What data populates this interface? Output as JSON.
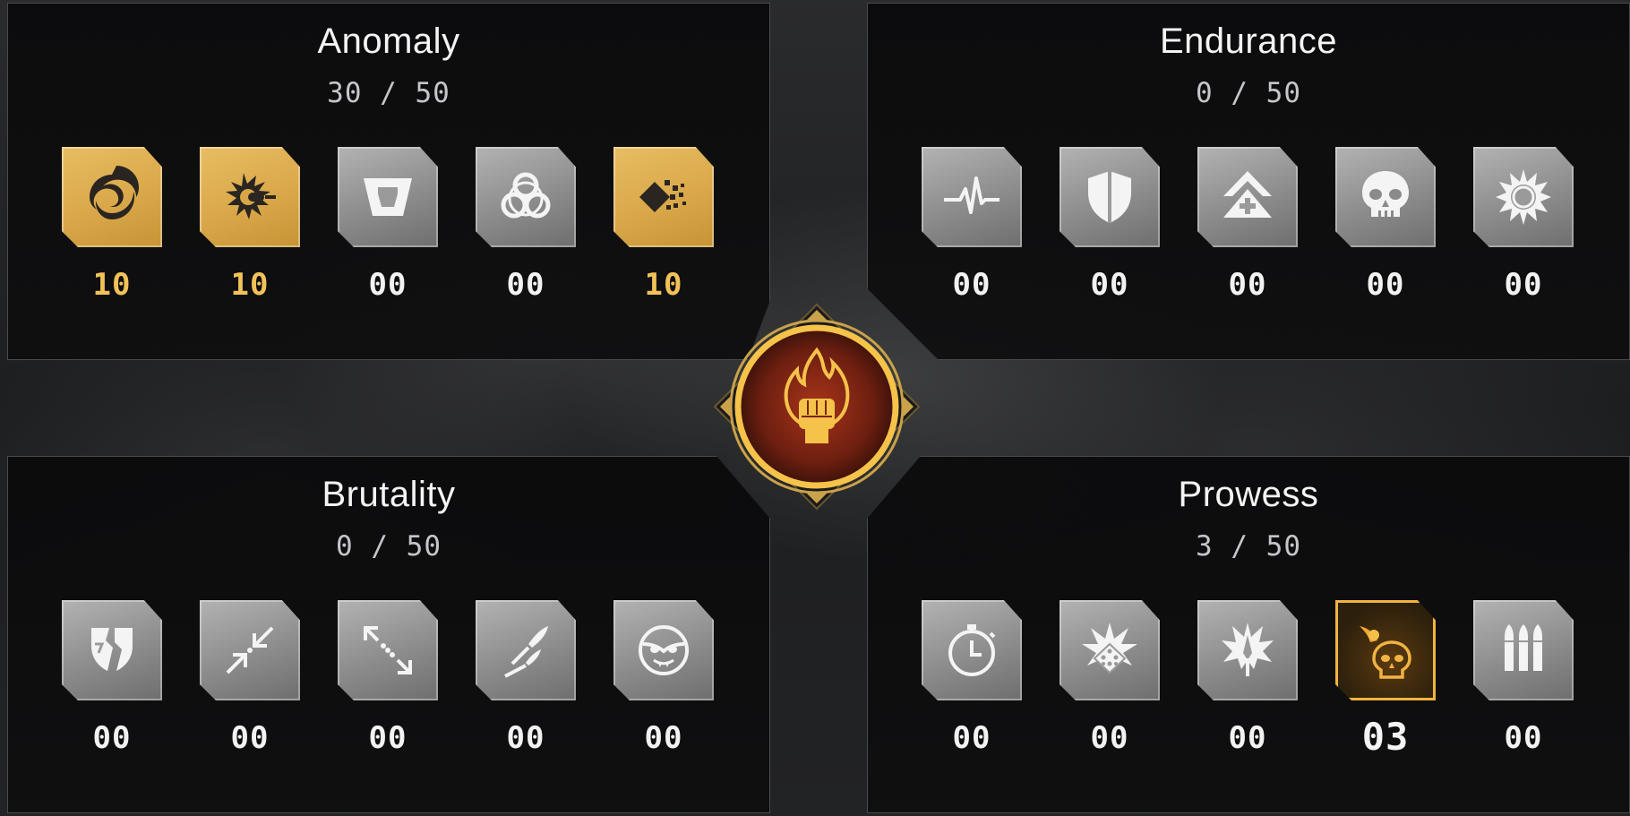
{
  "categories": [
    {
      "id": "anomaly",
      "title": "Anomaly",
      "score": "30 / 50",
      "tiles": [
        {
          "icon": "vortex-icon",
          "value": "10",
          "active": true
        },
        {
          "icon": "burning-bullet-icon",
          "value": "10",
          "active": true
        },
        {
          "icon": "trapezoid-icon",
          "value": "00",
          "active": false
        },
        {
          "icon": "biohazard-icon",
          "value": "00",
          "active": false
        },
        {
          "icon": "disintegrate-icon",
          "value": "10",
          "active": true
        }
      ]
    },
    {
      "id": "endurance",
      "title": "Endurance",
      "score": "0 / 50",
      "tiles": [
        {
          "icon": "heartbeat-icon",
          "value": "00",
          "active": false
        },
        {
          "icon": "shield-icon",
          "value": "00",
          "active": false
        },
        {
          "icon": "rank-heal-icon",
          "value": "00",
          "active": false
        },
        {
          "icon": "skull-icon",
          "value": "00",
          "active": false
        },
        {
          "icon": "sun-icon",
          "value": "00",
          "active": false
        }
      ]
    },
    {
      "id": "brutality",
      "title": "Brutality",
      "score": "0 / 50",
      "tiles": [
        {
          "icon": "broken-shield-icon",
          "value": "00",
          "active": false
        },
        {
          "icon": "converge-arrows-icon",
          "value": "00",
          "active": false
        },
        {
          "icon": "expand-arrows-icon",
          "value": "00",
          "active": false
        },
        {
          "icon": "blades-icon",
          "value": "00",
          "active": false
        },
        {
          "icon": "vampire-icon",
          "value": "00",
          "active": false
        }
      ]
    },
    {
      "id": "prowess",
      "title": "Prowess",
      "score": "3 / 50",
      "tiles": [
        {
          "icon": "stopwatch-icon",
          "value": "00",
          "active": false
        },
        {
          "icon": "explosive-dice-icon",
          "value": "00",
          "active": false
        },
        {
          "icon": "impact-blade-icon",
          "value": "00",
          "active": false
        },
        {
          "icon": "fire-skull-icon",
          "value": "03",
          "active": true,
          "selected": true
        },
        {
          "icon": "ammo-icon",
          "value": "00",
          "active": false
        }
      ]
    }
  ],
  "center_emblem": {
    "icon": "flaming-fist-icon"
  },
  "colors": {
    "gold": "#f2c158",
    "gold_tile": "#d8a648",
    "panel": "#0e0e0f",
    "ember": "#8a2a14"
  }
}
